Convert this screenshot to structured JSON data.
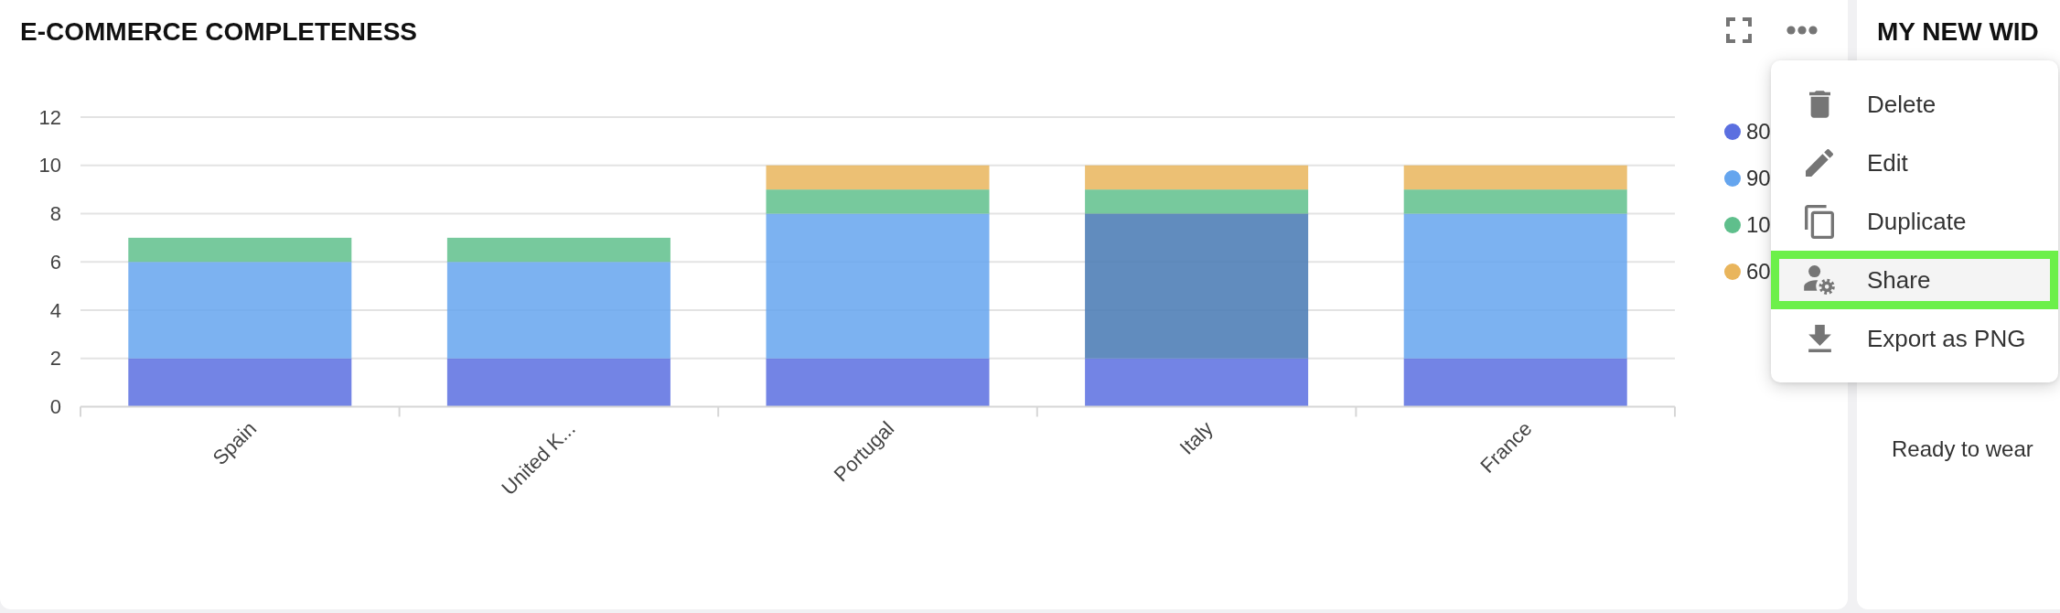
{
  "widgets": [
    {
      "title": "E-COMMERCE COMPLETENESS",
      "chart_data": {
        "type": "bar",
        "categories": [
          "Spain",
          "United K...",
          "Portugal",
          "Italy",
          "France"
        ],
        "series": [
          {
            "name": "80",
            "color": "#5b6fe0",
            "values": [
              2,
              2,
              2,
              2,
              2
            ]
          },
          {
            "name": "90",
            "color": "#65a5ee",
            "values": [
              4,
              4,
              6,
              6,
              6
            ]
          },
          {
            "name": "10",
            "color": "#5fbf8c",
            "values": [
              1,
              1,
              1,
              1,
              1
            ]
          },
          {
            "name": "60",
            "color": "#e9b55c",
            "values": [
              0,
              0,
              1,
              1,
              1
            ]
          }
        ],
        "ylim": [
          0,
          12
        ],
        "yticks": [
          0,
          2,
          4,
          6,
          8,
          10,
          12
        ],
        "stacked": true,
        "grid": true
      },
      "hovered_categories": [
        false,
        false,
        false,
        true,
        false
      ],
      "hovered_series": [
        false,
        true,
        false,
        false
      ],
      "menu": {
        "items": [
          {
            "label": "Delete",
            "selected": false
          },
          {
            "label": "Edit",
            "selected": false
          },
          {
            "label": "Duplicate",
            "selected": false
          },
          {
            "label": "Share",
            "selected": true
          },
          {
            "label": "Export as PNG",
            "selected": false
          }
        ]
      }
    },
    {
      "title": "MY NEW WID",
      "text": "Ready to wear"
    }
  ]
}
